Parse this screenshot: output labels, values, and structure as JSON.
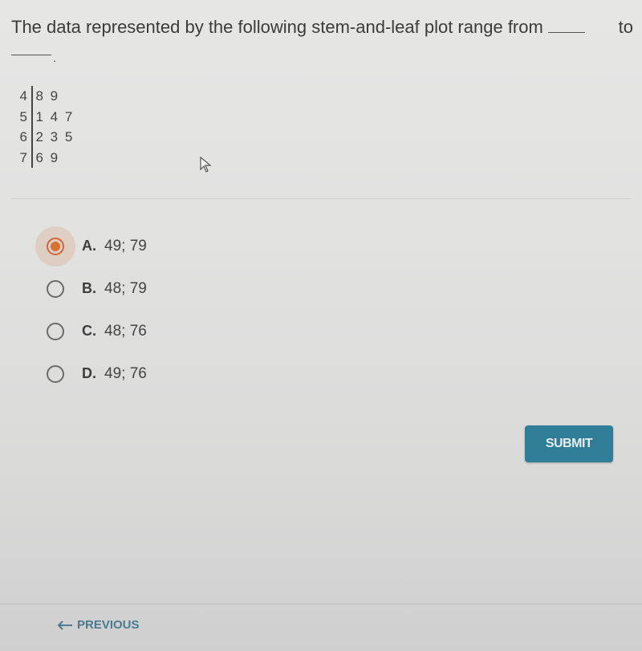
{
  "question": {
    "text_before": "The data represented by the following stem-and-leaf plot range from",
    "text_to": "to",
    "end_punct": "."
  },
  "stem_leaf": [
    {
      "stem": "4",
      "leaves": "8 9"
    },
    {
      "stem": "5",
      "leaves": "1 4 7"
    },
    {
      "stem": "6",
      "leaves": "2 3 5"
    },
    {
      "stem": "7",
      "leaves": "6 9"
    }
  ],
  "options": [
    {
      "letter": "A.",
      "text": "49; 79",
      "selected": true
    },
    {
      "letter": "B.",
      "text": "48; 79",
      "selected": false
    },
    {
      "letter": "C.",
      "text": "48; 76",
      "selected": false
    },
    {
      "letter": "D.",
      "text": "49; 76",
      "selected": false
    }
  ],
  "submit_label": "SUBMIT",
  "previous_label": "PREVIOUS",
  "colors": {
    "accent": "#2f7d97",
    "selected_radio": "#d8702f"
  }
}
